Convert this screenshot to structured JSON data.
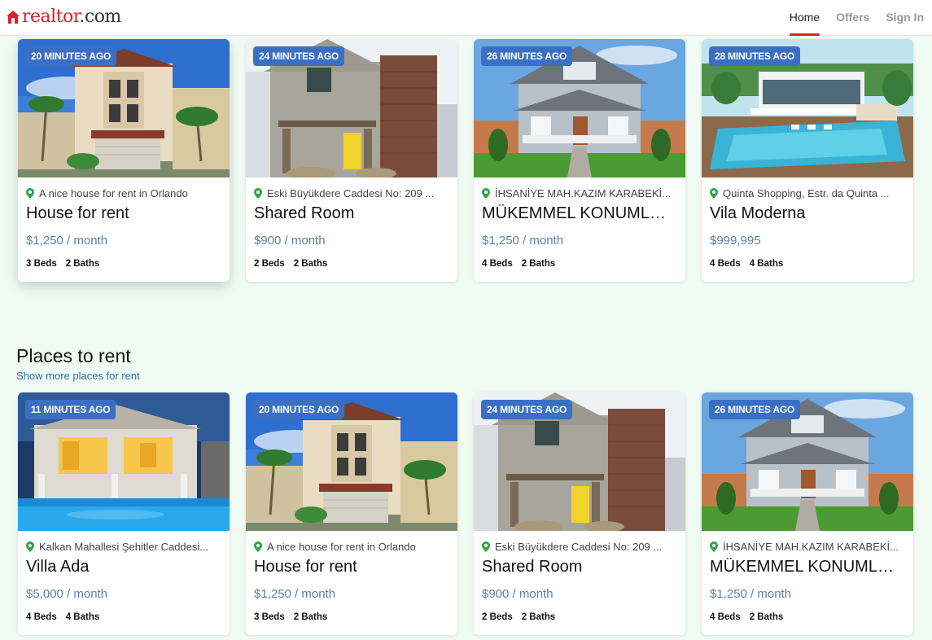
{
  "brand": {
    "name": "realtor",
    "suffix": ".com",
    "icon": "house-logo-icon",
    "color": "#d92228"
  },
  "nav": {
    "home": "Home",
    "offers": "Offers",
    "sign_in": "Sign In"
  },
  "section_offers": {
    "cards": [
      {
        "time": "20 MINUTES AGO",
        "address": "A nice house for rent in Orlando",
        "title": "House for rent",
        "price": "$1,250 / month",
        "beds": "3 Beds",
        "baths": "2 Baths"
      },
      {
        "time": "24 MINUTES AGO",
        "address": "Eski Büyükdere Caddesi No: 209 ...",
        "title": "Shared Room",
        "price": "$900 / month",
        "beds": "2 Beds",
        "baths": "2 Baths"
      },
      {
        "time": "26 MINUTES AGO",
        "address": "İHSANİYE MAH.KAZIM KARABEKİ...",
        "title": "MÜKEMMEL KONUMLU ...",
        "price": "$1,250 / month",
        "beds": "4 Beds",
        "baths": "2 Baths"
      },
      {
        "time": "28 MINUTES AGO",
        "address": "Quinta Shopping, Estr. da Quinta ...",
        "title": "Vila Moderna",
        "price": "$999,995",
        "beds": "4 Beds",
        "baths": "4 Baths"
      }
    ]
  },
  "section_rent": {
    "title": "Places to rent",
    "link": "Show more places for rent",
    "cards": [
      {
        "time": "11 MINUTES AGO",
        "address": "Kalkan Mahallesi Şehitler Caddesi...",
        "title": "Villa Ada",
        "price": "$5,000 / month",
        "beds": "4 Beds",
        "baths": "4 Baths"
      },
      {
        "time": "20 MINUTES AGO",
        "address": "A nice house for rent in Orlando",
        "title": "House for rent",
        "price": "$1,250 / month",
        "beds": "3 Beds",
        "baths": "2 Baths"
      },
      {
        "time": "24 MINUTES AGO",
        "address": "Eski Büyükdere Caddesi No: 209 ...",
        "title": "Shared Room",
        "price": "$900 / month",
        "beds": "2 Beds",
        "baths": "2 Baths"
      },
      {
        "time": "26 MINUTES AGO",
        "address": "İHSANİYE MAH.KAZIM KARABEKİ...",
        "title": "MÜKEMMEL KONUMLU ...",
        "price": "$1,250 / month",
        "beds": "4 Beds",
        "baths": "2 Baths"
      }
    ]
  },
  "colors": {
    "badge": "#3a6fc4",
    "price": "#5a7fa6",
    "pin": "#2ea84a",
    "page_bg": "#f0fbf4",
    "link": "#2f6fb3"
  }
}
